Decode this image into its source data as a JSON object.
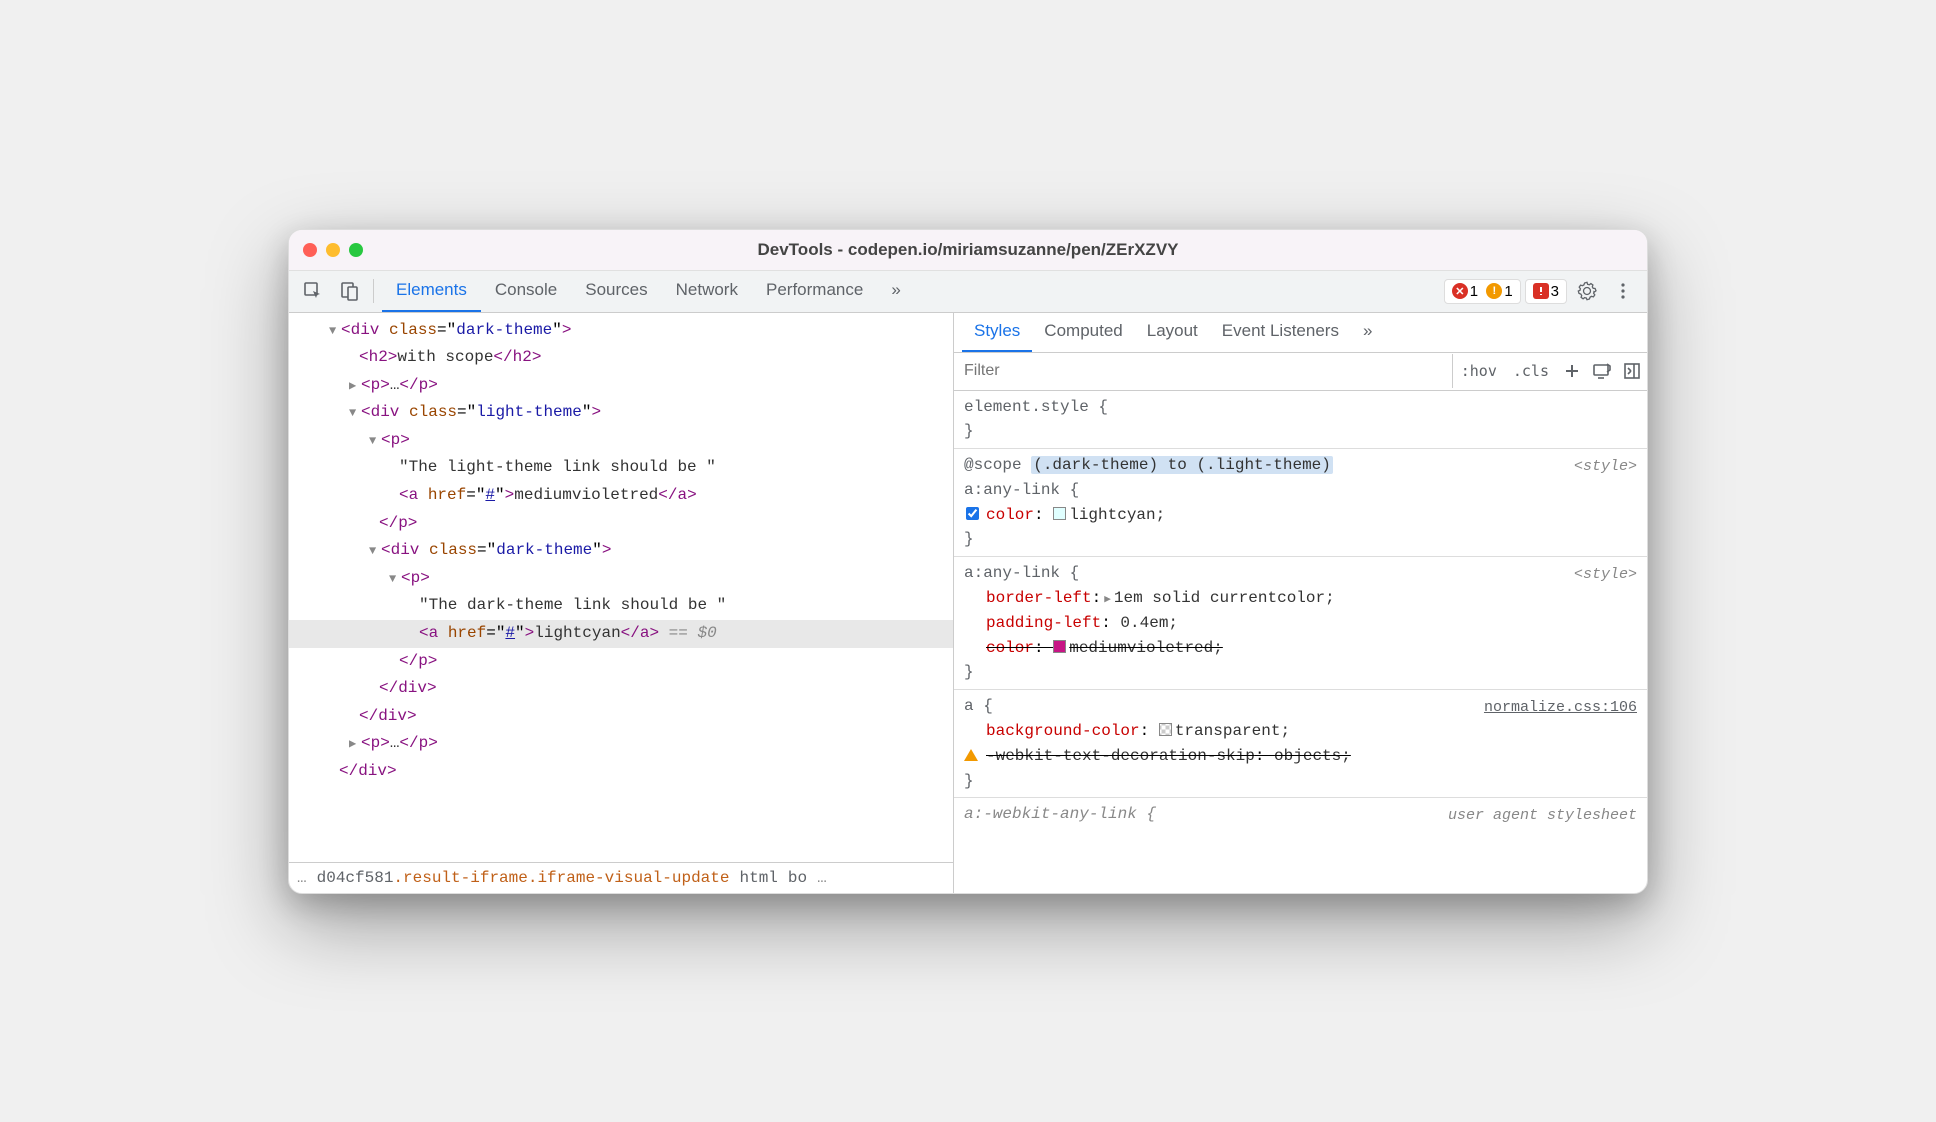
{
  "window": {
    "title": "DevTools - codepen.io/miriamsuzanne/pen/ZErXZVY"
  },
  "toolbar": {
    "tabs": [
      "Elements",
      "Console",
      "Sources",
      "Network",
      "Performance"
    ],
    "more": "»",
    "errors": "1",
    "warnings": "1",
    "issues": "3"
  },
  "dom": {
    "l1_open": "<div class=\"dark-theme\">",
    "l2": "<h2>with scope</h2>",
    "l3": "<p>…</p>",
    "l4_open": "<div class=\"light-theme\">",
    "l5_open": "<p>",
    "l6_text": "\"The light-theme link should be \"",
    "l7": "<a href=\"#\">mediumvioletred</a>",
    "l8": "</p>",
    "l9_open": "<div class=\"dark-theme\">",
    "l10_open": "<p>",
    "l11_text": "\"The dark-theme link should be \"",
    "l12": "<a href=\"#\">lightcyan</a>",
    "l12_sel": " == $0",
    "l13": "</p>",
    "l14": "</div>",
    "l15": "</div>",
    "l16": "<p>…</p>",
    "l17": "</div>"
  },
  "breadcrumb": {
    "ellipsis": "…",
    "id": "d04cf581",
    "cls": ".result-iframe.iframe-visual-update",
    "items": [
      "html",
      "bo"
    ],
    "trail_ellipsis": "…"
  },
  "stylesTabs": [
    "Styles",
    "Computed",
    "Layout",
    "Event Listeners"
  ],
  "stylesMore": "»",
  "filter": {
    "placeholder": "Filter",
    "hov": ":hov",
    "cls": ".cls"
  },
  "rules": {
    "r0_sel": "element.style {",
    "r0_close": "}",
    "r1_scope_kw": "@scope",
    "r1_scope_expr": "(.dark-theme) to (.light-theme)",
    "r1_sel": "a:any-link {",
    "r1_source": "<style>",
    "r1_p1_name": "color",
    "r1_p1_val": "lightcyan;",
    "r1_close": "}",
    "r2_sel": "a:any-link {",
    "r2_source": "<style>",
    "r2_p1_name": "border-left",
    "r2_p1_val": "1em solid currentcolor;",
    "r2_p2_name": "padding-left",
    "r2_p2_val": "0.4em;",
    "r2_p3_name": "color",
    "r2_p3_val": "mediumvioletred;",
    "r2_close": "}",
    "r3_sel": "a {",
    "r3_source": "normalize.css:106",
    "r3_p1_name": "background-color",
    "r3_p1_val": "transparent;",
    "r3_p2_name": "-webkit-text-decoration-skip",
    "r3_p2_val": "objects;",
    "r3_close": "}",
    "r4_sel": "a:-webkit-any-link {",
    "r4_source": "user agent stylesheet"
  },
  "colors": {
    "lightcyan": "#e0ffff",
    "mediumvioletred": "#c71585",
    "transparent": "transparent"
  }
}
